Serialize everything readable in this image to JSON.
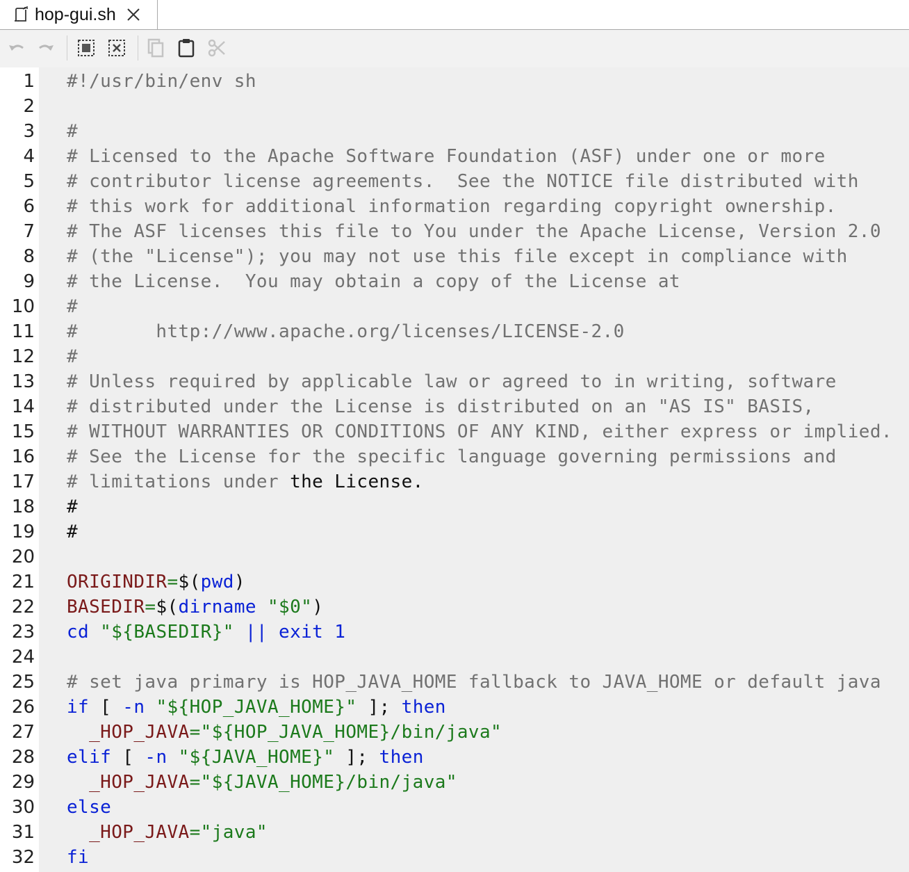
{
  "tab": {
    "title": "hop-gui.sh"
  },
  "toolbar": {
    "items": [
      {
        "icon": "undo-icon"
      },
      {
        "icon": "redo-icon"
      },
      {
        "icon": "select-all-icon"
      },
      {
        "icon": "unselect-all-icon"
      },
      {
        "icon": "copy-icon"
      },
      {
        "icon": "paste-icon"
      },
      {
        "icon": "cut-icon"
      }
    ]
  },
  "editor": {
    "line_numbers": [
      "1",
      "2",
      "3",
      "4",
      "5",
      "6",
      "7",
      "8",
      "9",
      "10",
      "11",
      "12",
      "13",
      "14",
      "15",
      "16",
      "17",
      "18",
      "19",
      "20",
      "21",
      "22",
      "23",
      "24",
      "25",
      "26",
      "27",
      "28",
      "29",
      "30",
      "31",
      "32"
    ],
    "lines": [
      [
        {
          "t": "#!/usr/bin/env sh",
          "c": "comment"
        }
      ],
      [],
      [
        {
          "t": "#",
          "c": "comment"
        }
      ],
      [
        {
          "t": "# Licensed to the Apache Software Foundation (ASF) under one or more",
          "c": "comment"
        }
      ],
      [
        {
          "t": "# contributor license agreements.  See the NOTICE file distributed with",
          "c": "comment"
        }
      ],
      [
        {
          "t": "# this work for additional information regarding copyright ownership.",
          "c": "comment"
        }
      ],
      [
        {
          "t": "# The ASF licenses this file to You under the Apache License, Version 2.0",
          "c": "comment"
        }
      ],
      [
        {
          "t": "# (the \"License\"); you may not use this file except in compliance with",
          "c": "comment"
        }
      ],
      [
        {
          "t": "# the License.  You may obtain a copy of the License at",
          "c": "comment"
        }
      ],
      [
        {
          "t": "#",
          "c": "comment"
        }
      ],
      [
        {
          "t": "#       http://www.apache.org/licenses/LICENSE-2.0",
          "c": "comment"
        }
      ],
      [
        {
          "t": "#",
          "c": "comment"
        }
      ],
      [
        {
          "t": "# Unless required by applicable law or agreed to in writing, software",
          "c": "comment"
        }
      ],
      [
        {
          "t": "# distributed under the License is distributed on an \"AS IS\" BASIS,",
          "c": "comment"
        }
      ],
      [
        {
          "t": "# WITHOUT WARRANTIES OR CONDITIONS OF ANY KIND, either express or implied.",
          "c": "comment"
        }
      ],
      [
        {
          "t": "# See the License for the specific language governing permissions and",
          "c": "comment"
        }
      ],
      [
        {
          "t": "# limitations under ",
          "c": "comment"
        },
        {
          "t": "the License.",
          "c": "black"
        }
      ],
      [
        {
          "t": "#",
          "c": "black"
        }
      ],
      [
        {
          "t": "#",
          "c": "black"
        }
      ],
      [],
      [
        {
          "t": "ORIGINDIR",
          "c": "var"
        },
        {
          "t": "=",
          "c": "str"
        },
        {
          "t": "$(",
          "c": "black"
        },
        {
          "t": "pwd",
          "c": "kw"
        },
        {
          "t": ")",
          "c": "black"
        }
      ],
      [
        {
          "t": "BASEDIR",
          "c": "var"
        },
        {
          "t": "=",
          "c": "str"
        },
        {
          "t": "$(",
          "c": "black"
        },
        {
          "t": "dirname",
          "c": "kw"
        },
        {
          "t": " ",
          "c": "black"
        },
        {
          "t": "\"$0\"",
          "c": "str"
        },
        {
          "t": ")",
          "c": "black"
        }
      ],
      [
        {
          "t": "cd",
          "c": "kw"
        },
        {
          "t": " ",
          "c": "black"
        },
        {
          "t": "\"${BASEDIR}\"",
          "c": "str"
        },
        {
          "t": " || exit 1",
          "c": "kw"
        }
      ],
      [],
      [
        {
          "t": "# set java primary is HOP_JAVA_HOME fallback to JAVA_HOME or default java",
          "c": "comment"
        }
      ],
      [
        {
          "t": "if",
          "c": "kw"
        },
        {
          "t": " [ ",
          "c": "black"
        },
        {
          "t": "-n",
          "c": "kw"
        },
        {
          "t": " ",
          "c": "black"
        },
        {
          "t": "\"${HOP_JAVA_HOME}\"",
          "c": "str"
        },
        {
          "t": " ]; ",
          "c": "black"
        },
        {
          "t": "then",
          "c": "kw"
        }
      ],
      [
        {
          "t": "  _HOP_JAVA",
          "c": "var"
        },
        {
          "t": "=\"${HOP_JAVA_HOME}/bin/java\"",
          "c": "str"
        }
      ],
      [
        {
          "t": "elif",
          "c": "kw"
        },
        {
          "t": " [ ",
          "c": "black"
        },
        {
          "t": "-n",
          "c": "kw"
        },
        {
          "t": " ",
          "c": "black"
        },
        {
          "t": "\"${JAVA_HOME}\"",
          "c": "str"
        },
        {
          "t": " ]; ",
          "c": "black"
        },
        {
          "t": "then",
          "c": "kw"
        }
      ],
      [
        {
          "t": "  _HOP_JAVA",
          "c": "var"
        },
        {
          "t": "=\"${JAVA_HOME}/bin/java\"",
          "c": "str"
        }
      ],
      [
        {
          "t": "else",
          "c": "kw"
        }
      ],
      [
        {
          "t": "  _HOP_JAVA",
          "c": "var"
        },
        {
          "t": "=\"java\"",
          "c": "str"
        }
      ],
      [
        {
          "t": "fi",
          "c": "kw"
        }
      ]
    ]
  }
}
